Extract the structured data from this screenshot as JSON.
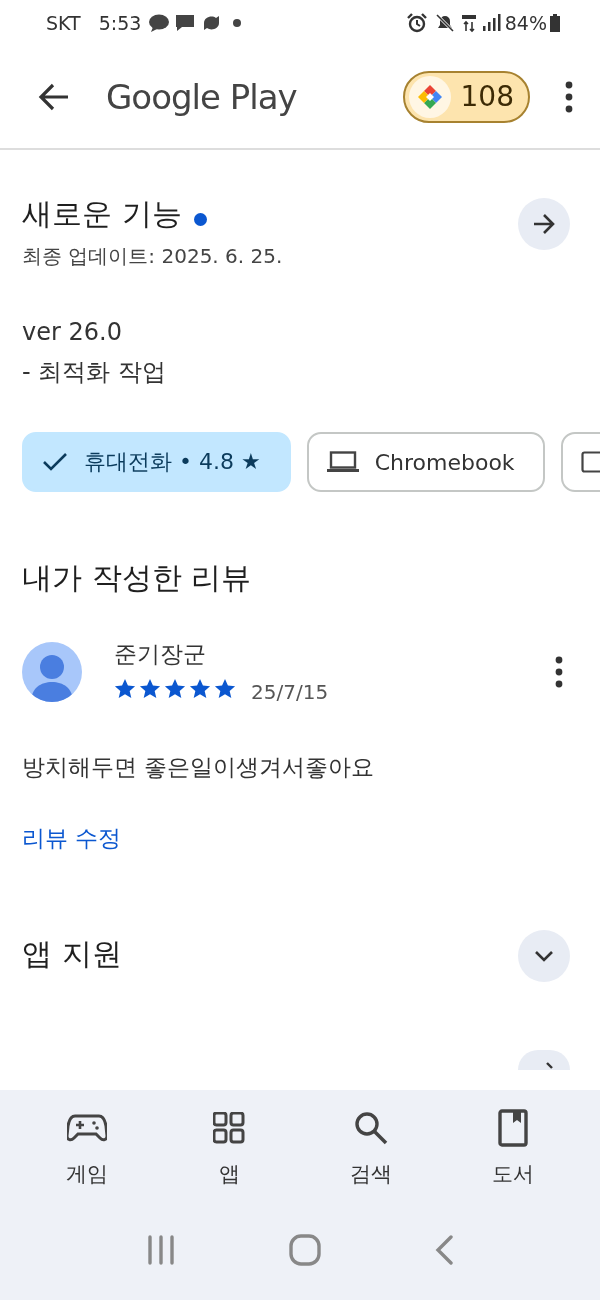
{
  "status_bar": {
    "carrier": "SKT",
    "time": "5:53",
    "battery": "84%"
  },
  "app_bar": {
    "title": "Google Play",
    "points": "108"
  },
  "whats_new": {
    "title": "새로운 기능",
    "has_new": true,
    "updated": "최종 업데이트: 2025. 6. 25.",
    "lines": [
      "ver 26.0",
      "- 최적화 작업"
    ]
  },
  "device_chips": [
    {
      "kind": "phone",
      "label": "휴대전화 • 4.8 ★",
      "selected": true
    },
    {
      "kind": "laptop",
      "label": "Chromebook",
      "selected": false
    },
    {
      "kind": "tablet",
      "selected": false
    }
  ],
  "my_review": {
    "title": "내가 작성한 리뷰",
    "author": "준기장군",
    "stars": 5,
    "date": "25/7/15",
    "text": "방치해두면 좋은일이생겨서좋아요",
    "edit_link": "리뷰 수정"
  },
  "sections": [
    {
      "kind": "expand",
      "title": "앱 지원"
    },
    {
      "kind": "arrow"
    }
  ],
  "bottom_nav": [
    {
      "kind": "games",
      "label": "게임",
      "selected": false
    },
    {
      "kind": "apps",
      "label": "앱",
      "selected": false
    },
    {
      "kind": "search",
      "label": "검색",
      "selected": false
    },
    {
      "kind": "books",
      "label": "도서",
      "selected": false
    }
  ]
}
